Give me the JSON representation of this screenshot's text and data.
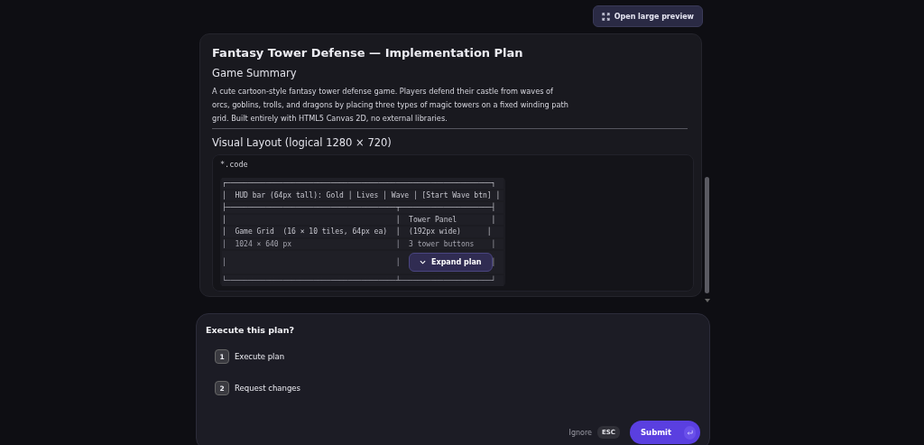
{
  "preview_button": {
    "label": "Open large preview"
  },
  "plan": {
    "title": "Fantasy Tower Defense — Implementation Plan",
    "summary_heading": "Game Summary",
    "summary": "A cute cartoon-style fantasy tower defense game. Players defend their castle from waves of orcs, goblins, trolls, and dragons by placing three types of magic towers on a fixed winding path grid. Built entirely with HTML5 Canvas 2D, no external libraries.",
    "layout_heading": "Visual Layout (logical 1280 × 720)",
    "code_label": "*.code",
    "code_lines": [
      "┌─────────────────────────────────────────────────────────────┐",
      "│  HUD bar (64px tall): Gold │ Lives │ Wave │ [Start Wave btn] │",
      "├───────────────────────────────────────┬─────────────────────┤",
      "│                                       │  Tower Panel        │",
      "│  Game Grid  (16 × 10 tiles, 64px ea)  │  (192px wide)      │",
      "│  1024 × 640 px                        │  3 tower buttons    │",
      "│                                       │                     │",
      "└───────────────────────────────────────┴─────────────────────┘"
    ],
    "expand_button": {
      "label": "Expand plan"
    }
  },
  "prompt": {
    "question": "Execute this plan?",
    "options": [
      {
        "number": "1",
        "label": "Execute plan"
      },
      {
        "number": "2",
        "label": "Request changes"
      }
    ],
    "ignore": {
      "label": "Ignore",
      "key": "ESC"
    },
    "submit": {
      "label": "Submit"
    }
  }
}
